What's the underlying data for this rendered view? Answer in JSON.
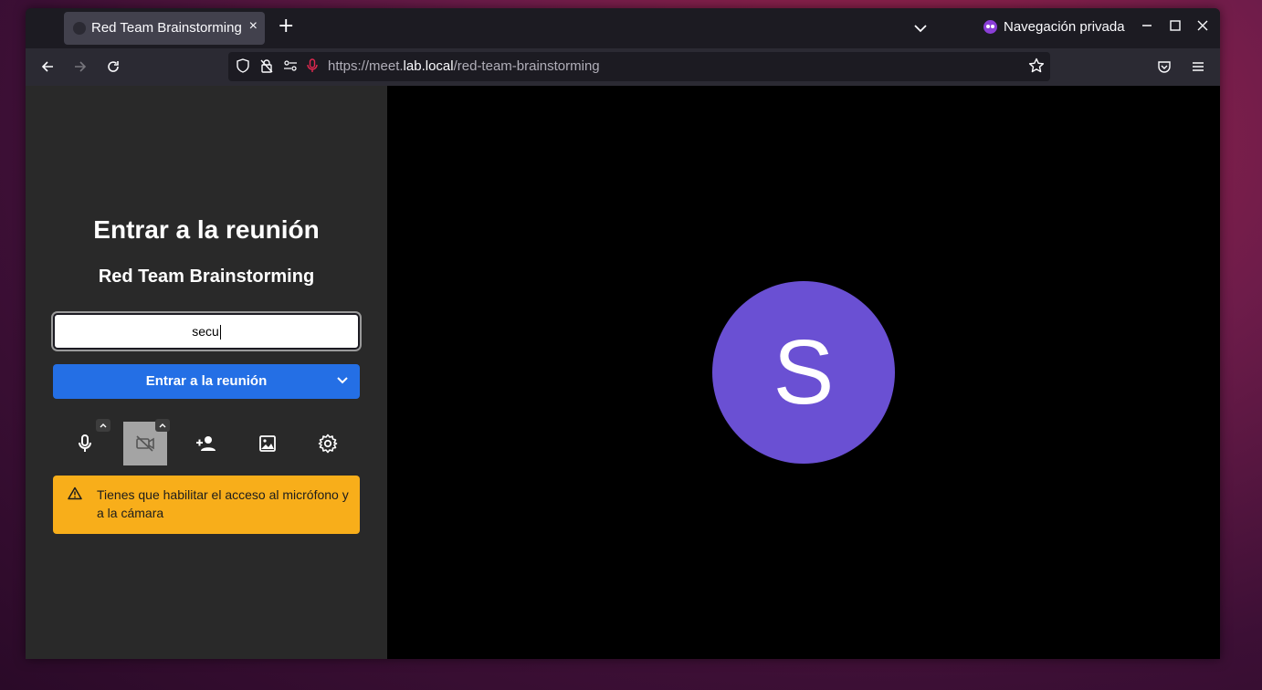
{
  "browser": {
    "tab": {
      "title": "Red Team Brainstorming",
      "close": "×"
    },
    "new_tab": "+",
    "private_label": "Navegación privada",
    "window_controls": {
      "minimize": "—",
      "maximize": "☐",
      "close": "✕"
    },
    "url": {
      "prefix": "https://meet.",
      "domain": "lab.local",
      "path": "/red-team-brainstorming"
    }
  },
  "prejoin": {
    "title": "Entrar a la reunión",
    "meeting_name": "Red Team Brainstorming",
    "name_value": "secu",
    "join_label": "Entrar a la reunión",
    "warning": "Tienes que habilitar el acceso al micrófono y a la cámara"
  },
  "toolbar": {
    "icons": [
      "microphone-icon",
      "camera-off-icon",
      "invite-person-icon",
      "background-image-icon",
      "settings-gear-icon"
    ]
  },
  "avatar": {
    "initial": "S",
    "color": "#6a50d3"
  },
  "colors": {
    "join_button": "#246fe5",
    "warning": "#f8ae1a",
    "panel": "#292929"
  }
}
